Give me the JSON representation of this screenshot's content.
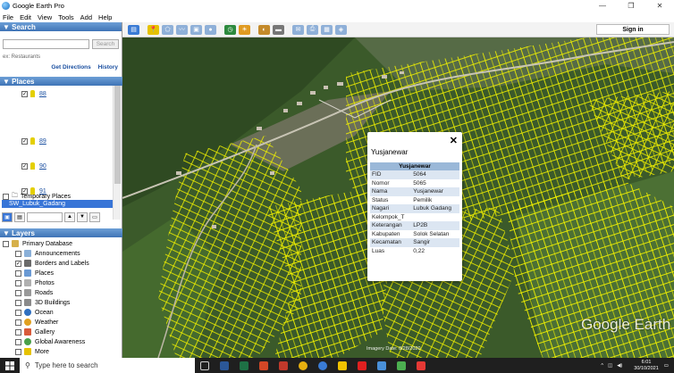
{
  "window": {
    "title": "Google Earth Pro",
    "controls": [
      "—",
      "❐",
      "✕"
    ]
  },
  "menu": [
    "File",
    "Edit",
    "View",
    "Tools",
    "Add",
    "Help"
  ],
  "toolbar": {
    "signin": "Sign in"
  },
  "search": {
    "header": "Search",
    "button": "Search",
    "hint": "ex: Restaurants",
    "get_directions": "Get Directions",
    "history": "History"
  },
  "places": {
    "header": "Places",
    "items": [
      "88",
      "89",
      "90",
      "91"
    ],
    "temporary": "Temporary Places",
    "selected": "SW_Lubuk_Gadang"
  },
  "layers": {
    "header": "Layers",
    "items": [
      "Primary Database",
      "Announcements",
      "Borders and Labels",
      "Places",
      "Photos",
      "Roads",
      "3D Buildings",
      "Ocean",
      "Weather",
      "Gallery",
      "Global Awareness",
      "More"
    ]
  },
  "popup": {
    "title": "Yusjanewar",
    "header": "Yusjanewar",
    "rows": [
      [
        "FID",
        "5064"
      ],
      [
        "Nomor",
        "5065"
      ],
      [
        "Nama",
        "Yusjanewar"
      ],
      [
        "Status",
        "Pemilik"
      ],
      [
        "Nagari",
        "Lubuk Gadang"
      ],
      [
        "Kelompok_T",
        ""
      ],
      [
        "Keterangan",
        "LP2B"
      ],
      [
        "Kabupaten",
        "Solok Selatan"
      ],
      [
        "Kecamatan",
        "Sangir"
      ],
      [
        "Luas",
        "0,22"
      ]
    ],
    "close": "✕"
  },
  "map": {
    "logo": "Google Earth",
    "status": "Imagery Date: 8/28/2020"
  },
  "taskbar": {
    "search_placeholder": "Type here to search",
    "time": "6:01",
    "date": "30/10/2021"
  },
  "colors": {
    "accent": "#3875d7",
    "parcel": "#f2f200"
  }
}
